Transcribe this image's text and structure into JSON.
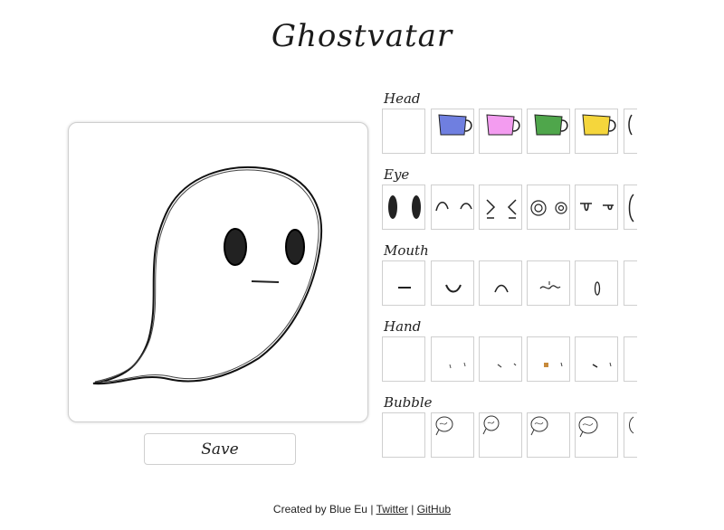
{
  "app": {
    "title": "Ghostvatar"
  },
  "preview": {
    "save_label": "Save"
  },
  "sections": {
    "head": {
      "label": "Head",
      "items": [
        "empty",
        "blue-mug",
        "pink-mug",
        "green-mug",
        "yellow-mug",
        "mug-partial"
      ]
    },
    "eye": {
      "label": "Eye",
      "items": [
        "oval-eyes",
        "arch-eyes",
        "angled-eyes",
        "spiral-eyes",
        "droopy-eyes",
        "eye-partial"
      ]
    },
    "mouth": {
      "label": "Mouth",
      "items": [
        "flat-mouth",
        "smile-mouth",
        "frown-mouth",
        "wavy-mouth",
        "o-mouth",
        "mouth-partial"
      ]
    },
    "hand": {
      "label": "Hand",
      "items": [
        "empty",
        "hand-1",
        "hand-2",
        "hand-3",
        "hand-4",
        "hand-partial"
      ]
    },
    "bubble": {
      "label": "Bubble",
      "items": [
        "empty",
        "bubble-1",
        "bubble-2",
        "bubble-3",
        "bubble-4",
        "bubble-partial"
      ]
    }
  },
  "colors": {
    "blue": "#6f7fe0",
    "pink": "#f39cf0",
    "green": "#4fa64b",
    "yellow": "#f5d63c"
  },
  "footer": {
    "prefix": "Created by Blue Eu |",
    "twitter": "Twitter",
    "separator": "|",
    "github": "GitHub"
  }
}
